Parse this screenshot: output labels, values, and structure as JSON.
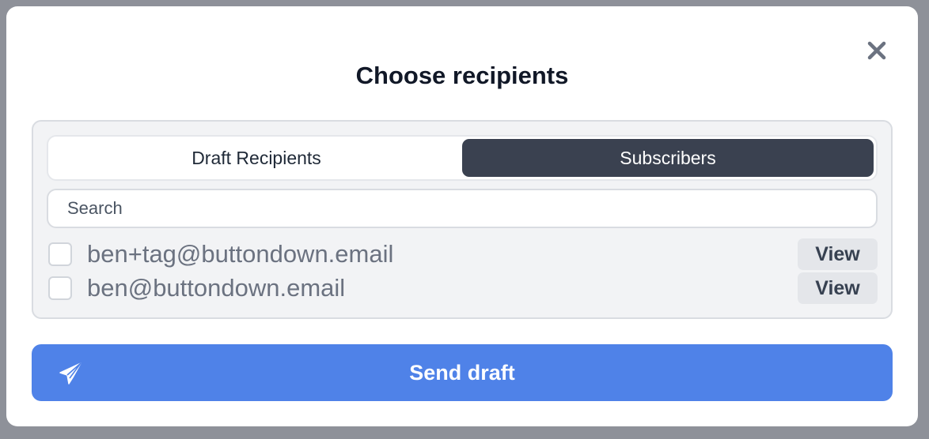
{
  "modal": {
    "title": "Choose recipients",
    "close_icon": "close-icon"
  },
  "tabs": [
    {
      "label": "Draft Recipients",
      "active": false
    },
    {
      "label": "Subscribers",
      "active": true
    }
  ],
  "search": {
    "placeholder": "Search",
    "value": ""
  },
  "recipients": [
    {
      "email": "ben+tag@buttondown.email",
      "checked": false,
      "action_label": "View"
    },
    {
      "email": "ben@buttondown.email",
      "checked": false,
      "action_label": "View"
    }
  ],
  "send": {
    "label": "Send draft",
    "icon": "paper-plane-icon"
  },
  "colors": {
    "accent": "#4f82e8",
    "active_tab": "#3a4150",
    "backdrop": "#8e9199"
  }
}
